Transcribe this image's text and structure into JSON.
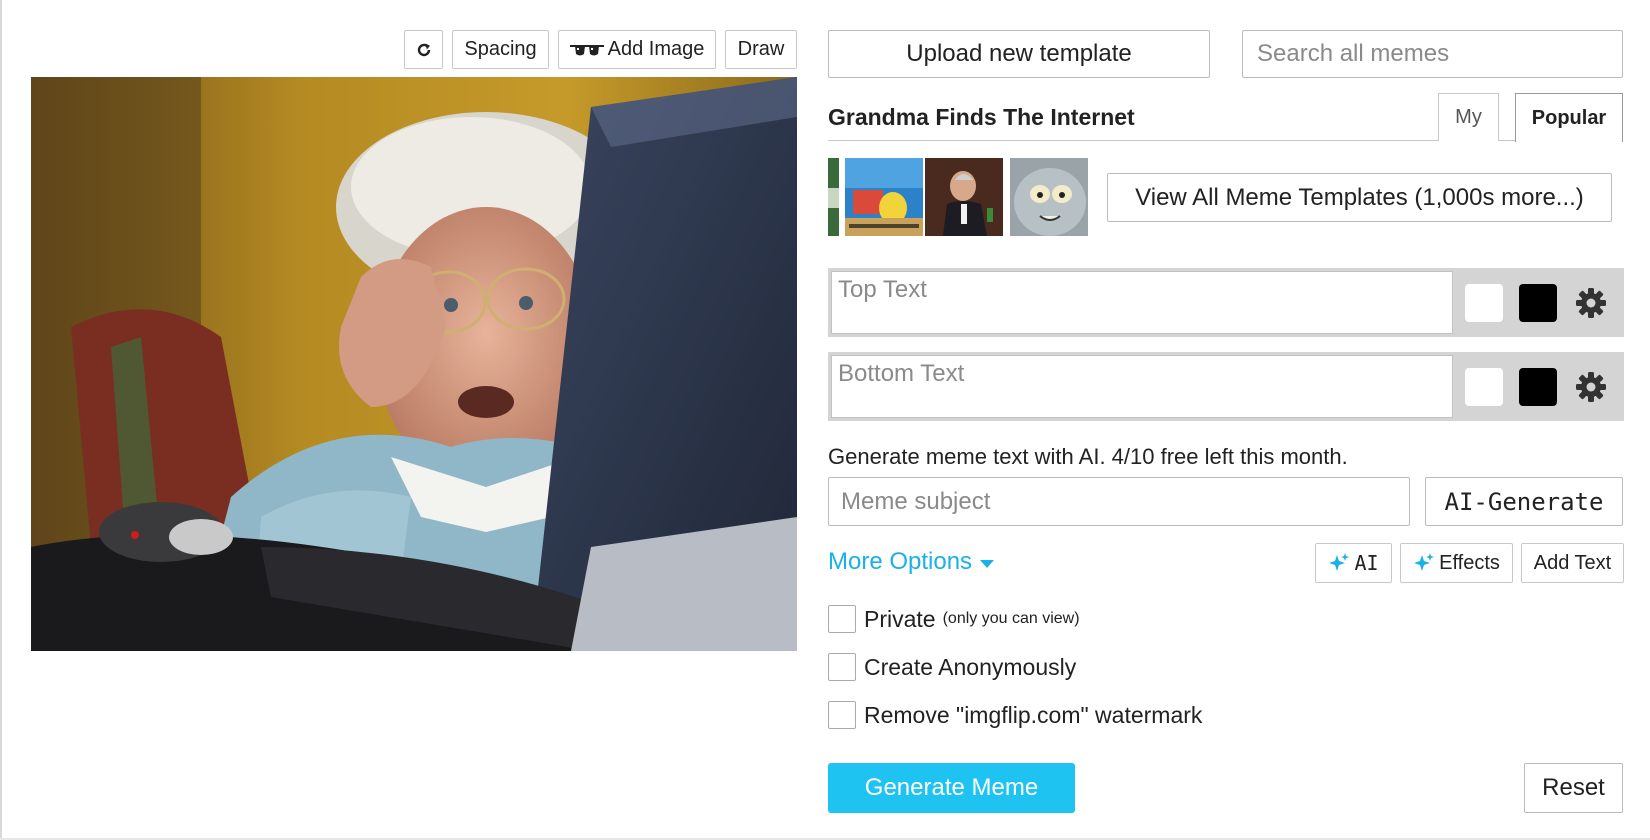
{
  "toolbar": {
    "rotate_icon": "rotate-icon",
    "spacing_label": "Spacing",
    "add_image_label": "Add Image",
    "draw_label": "Draw"
  },
  "header": {
    "upload_label": "Upload new template",
    "search_placeholder": "Search all memes"
  },
  "template": {
    "title": "Grandma Finds The Internet",
    "tabs": [
      {
        "label": "My",
        "active": false
      },
      {
        "label": "Popular",
        "active": true
      }
    ],
    "thumbnails": [
      "partial-thumbnail",
      "spongebob-thumbnail",
      "most-interesting-man-thumbnail",
      "unsettled-tom-thumbnail"
    ],
    "view_all_label": "View All Meme Templates (1,000s more...)"
  },
  "text_boxes": [
    {
      "placeholder": "Top Text",
      "outline_color": "#ffffff",
      "fill_color": "#000000"
    },
    {
      "placeholder": "Bottom Text",
      "outline_color": "#ffffff",
      "fill_color": "#000000"
    }
  ],
  "ai": {
    "note": "Generate meme text with AI. 4/10 free left this month.",
    "subject_placeholder": "Meme subject",
    "generate_label": "AI-Generate"
  },
  "options": {
    "more_options_label": "More Options",
    "ai_label": "AI",
    "effects_label": "Effects",
    "add_text_label": "Add Text"
  },
  "checkboxes": {
    "private_label": "Private",
    "private_sub": "(only you can view)",
    "anonymous_label": "Create Anonymously",
    "watermark_label": "Remove \"imgflip.com\" watermark"
  },
  "actions": {
    "generate_label": "Generate Meme",
    "reset_label": "Reset"
  },
  "colors": {
    "accent": "#1ec3f2",
    "link": "#1ab0e8"
  }
}
